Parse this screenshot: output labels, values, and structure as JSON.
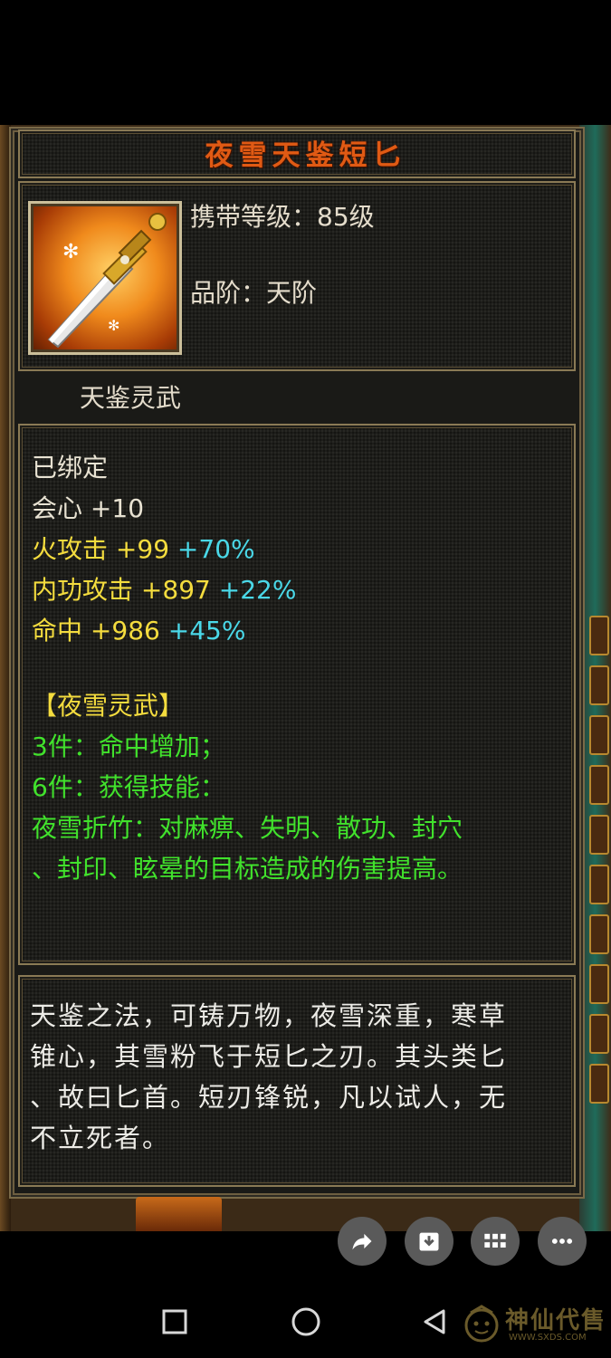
{
  "item": {
    "name": "夜雪天鉴短匕",
    "level_label": "携带等级：85级",
    "grade_label": "品阶：天阶",
    "series": "天鉴灵武"
  },
  "stats": {
    "bound": "已绑定",
    "crit": {
      "label": "会心",
      "value": "+10"
    },
    "fire": {
      "label": "火攻击",
      "value": "+99",
      "percent": "+70%"
    },
    "internal": {
      "label": "内功攻击",
      "value": "+897",
      "percent": "+22%"
    },
    "hit": {
      "label": "命中",
      "value": "+986",
      "percent": "+45%"
    }
  },
  "set_bonus": {
    "title": "【夜雪灵武】",
    "three": "3件：命中增加；",
    "six": "6件：获得技能：",
    "skill_line1": "夜雪折竹：对麻痹、失明、散功、封穴",
    "skill_line2": "、封印、眩晕的目标造成的伤害提高。"
  },
  "description": {
    "line1": "天鉴之法，可铸万物，夜雪深重，寒草",
    "line2": "锥心，其雪粉飞于短匕之刃。其头类匕",
    "line3": "、故曰匕首。短刃锋锐，凡以试人，无",
    "line4": "不立死者。"
  },
  "watermark": {
    "text": "神仙代售",
    "url": "WWW.SXDS.COM"
  },
  "icons": [
    "share-icon",
    "download-icon",
    "grid-icon",
    "more-icon",
    "recent-apps-icon",
    "home-icon",
    "back-icon"
  ],
  "colors": {
    "title": "#e05a14",
    "stat_value": "#f4dc3e",
    "percent": "#4ad8e8",
    "set": "#41e22c"
  }
}
